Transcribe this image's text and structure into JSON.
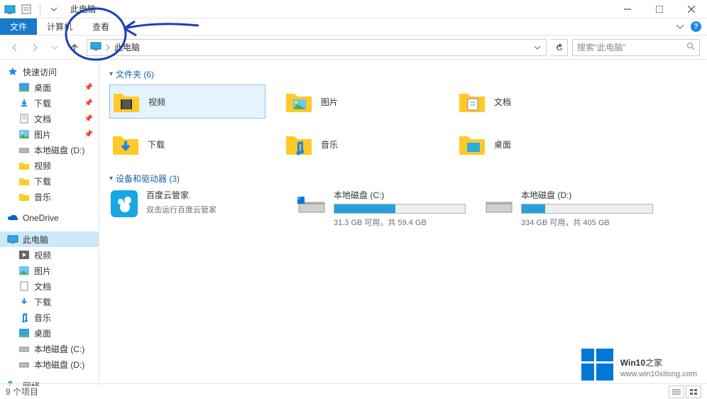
{
  "title": "此电脑",
  "ribbon": {
    "file": "文件",
    "tabs": [
      "计算机",
      "查看"
    ]
  },
  "breadcrumb": "此电脑",
  "search": {
    "placeholder": "搜索\"此电脑\""
  },
  "sidebar": {
    "quick": "快速访问",
    "quick_items": [
      {
        "label": "桌面",
        "pinned": true
      },
      {
        "label": "下载",
        "pinned": true
      },
      {
        "label": "文档",
        "pinned": true
      },
      {
        "label": "图片",
        "pinned": true
      },
      {
        "label": "本地磁盘 (D:)",
        "pinned": false
      },
      {
        "label": "视频",
        "pinned": false
      },
      {
        "label": "下载",
        "pinned": false
      },
      {
        "label": "音乐",
        "pinned": false
      }
    ],
    "onedrive": "OneDrive",
    "thispc": "此电脑",
    "thispc_items": [
      "视频",
      "图片",
      "文档",
      "下载",
      "音乐",
      "桌面",
      "本地磁盘 (C:)",
      "本地磁盘 (D:)"
    ],
    "network": "网络"
  },
  "groups": {
    "folders_header": "文件夹 (6)",
    "folders": [
      "视频",
      "图片",
      "文档",
      "下载",
      "音乐",
      "桌面"
    ],
    "drives_header": "设备和驱动器 (3)",
    "app": {
      "name": "百度云管家",
      "sub": "双击运行百度云管家"
    },
    "drives": [
      {
        "name": "本地磁盘 (C:)",
        "stat": "31.3 GB 可用，共 59.4 GB",
        "fill": 47
      },
      {
        "name": "本地磁盘 (D:)",
        "stat": "334 GB 可用，共 405 GB",
        "fill": 18
      }
    ]
  },
  "status": "9 个项目",
  "watermark": {
    "brand": "Win10",
    "suffix": "之家",
    "url": "www.win10xitong.com"
  }
}
